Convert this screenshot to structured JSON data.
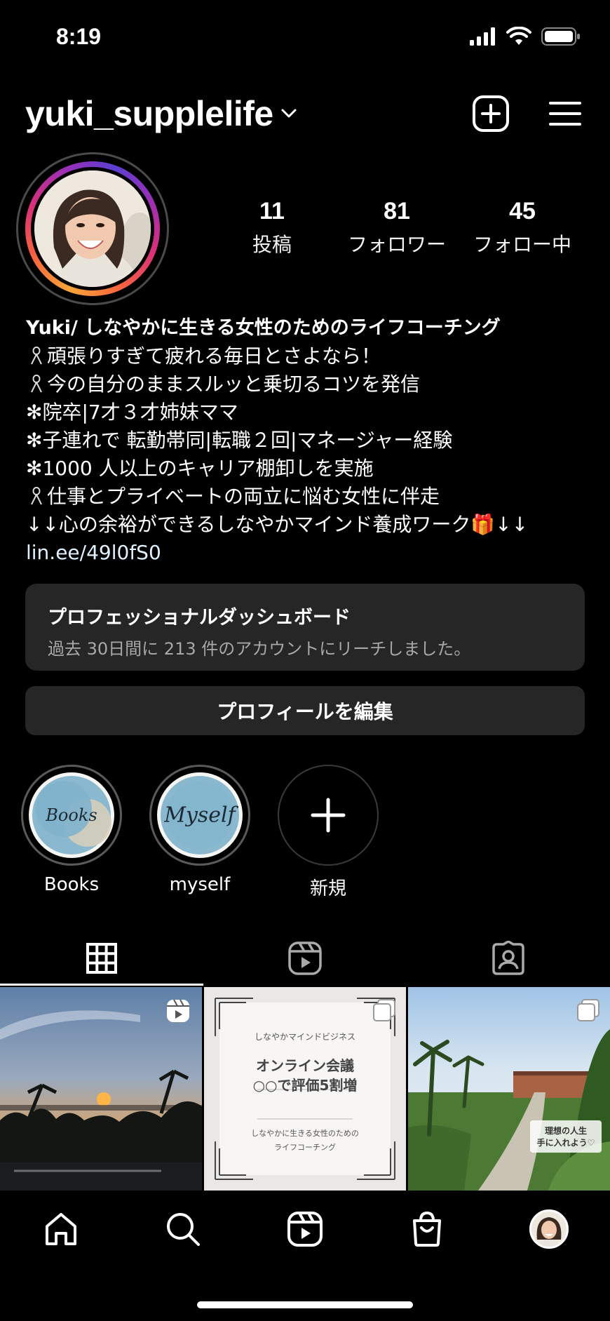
{
  "status_bar": {
    "time": "8:19"
  },
  "header": {
    "username": "yuki_supplelife"
  },
  "stats": [
    {
      "value": "11",
      "label": "投稿"
    },
    {
      "value": "81",
      "label": "フォロワー"
    },
    {
      "value": "45",
      "label": "フォロー中"
    }
  ],
  "bio": {
    "name": "Yuki/ しなやかに生きる女性のためのライフコーチング",
    "lines": [
      "頑張りすぎて疲れる毎日とさよなら！",
      "今の自分のままスルッと乗切るコツを発信",
      "✻院卒|7才３才姉妹ママ",
      "✻子連れで 転勤帯同|転職２回|マネージャー経験",
      "✻1000 人以上のキャリア棚卸しを実施",
      "仕事とプライベートの両立に悩む女性に伴走",
      "↓↓心の余裕ができるしなやかマインド養成ワーク🎁↓↓"
    ],
    "link": "lin.ee/49l0fS0"
  },
  "dashboard": {
    "title": "プロフェッショナルダッシュボード",
    "subtitle": "過去 30日間に 213 件のアカウントにリーチしました。"
  },
  "edit_profile": {
    "label": "プロフィールを編集"
  },
  "highlights": [
    {
      "label": "Books",
      "cover_text": "Books"
    },
    {
      "label": "myself",
      "cover_text": "Myself"
    },
    {
      "label": "新規"
    }
  ],
  "posts": [
    {
      "kind": "reel"
    },
    {
      "kind": "carousel",
      "top": "しなやかマインドビジネス",
      "headline1": "オンライン会議",
      "headline2": "○○で評価5割増",
      "footer1": "しなやかに生きる女性のための",
      "footer2": "ライフコーチング"
    },
    {
      "kind": "carousel",
      "caption1": "理想の人生",
      "caption2": "手に入れよう♡"
    }
  ],
  "colors": {
    "background": "#000000",
    "card": "#262626",
    "link": "#e0f1ff",
    "secondary_text": "#a8a8a8"
  }
}
